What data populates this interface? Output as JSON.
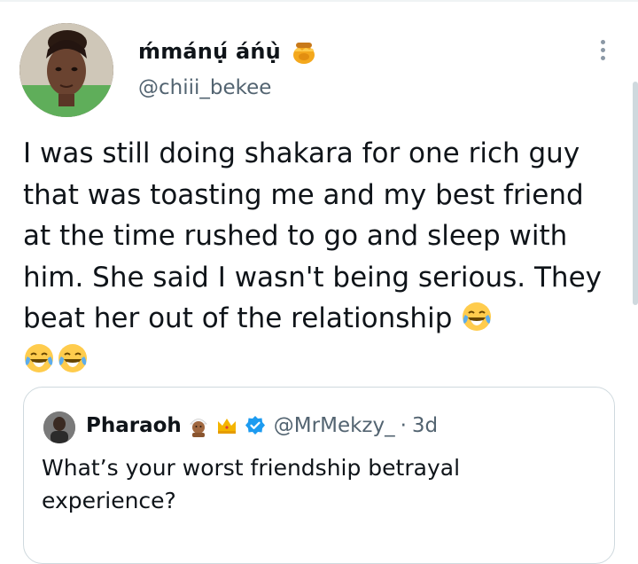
{
  "tweet": {
    "author_name": "ḿmánụ́ áńụ̀",
    "author_handle": "@chiii_bekee",
    "text": "I was still doing shakara for one rich guy that was toasting me and my best friend at the time rushed to go and sleep with him. She said I wasn't being serious. They beat her out of the relationship",
    "name_emoji_icon": "honey-pot-icon",
    "trailing_emoji_icon": "face-with-tears-of-joy-icon",
    "trailing_emoji_count": 3
  },
  "quoted_tweet": {
    "author_name": "Pharaoh",
    "author_handle": "@MrMekzy_",
    "separator": "·",
    "time": "3d",
    "text": "What’s your worst friendship betrayal experience?",
    "name_icons": [
      "man-with-turban-icon",
      "crown-icon",
      "verified-badge-icon"
    ]
  },
  "colors": {
    "text": "#0f1419",
    "secondary": "#536471",
    "border": "#cfd9de",
    "verified": "#1d9bf0"
  }
}
